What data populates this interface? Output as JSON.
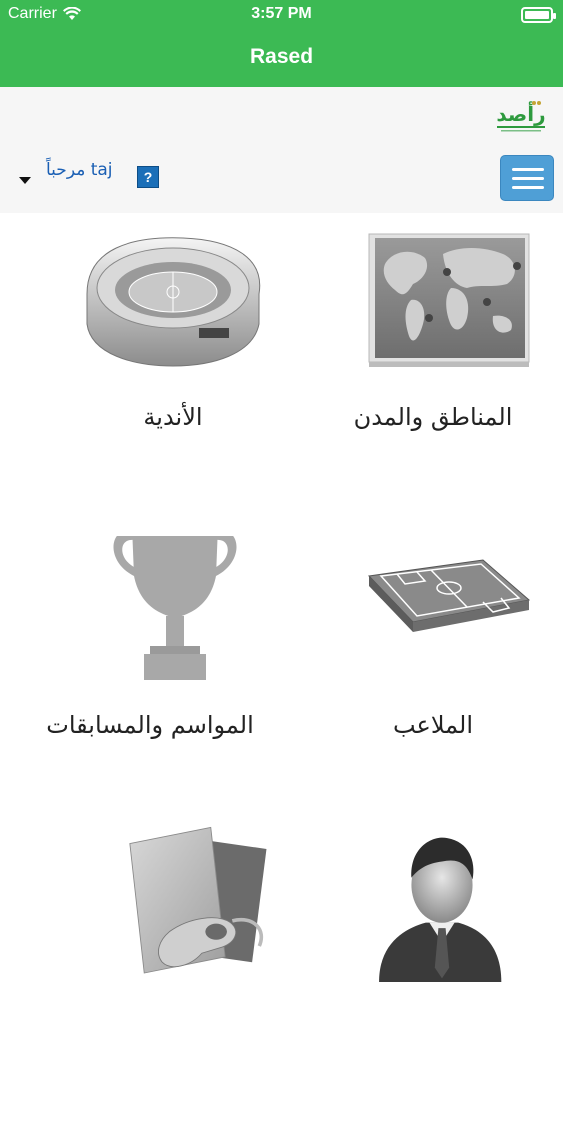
{
  "status_bar": {
    "carrier": "Carrier",
    "time": "3:57 PM"
  },
  "nav": {
    "title": "Rased"
  },
  "header": {
    "greeting": "مرحباً taj",
    "help_label": "?"
  },
  "menu": [
    {
      "key": "regions",
      "label": "المناطق والمدن",
      "icon": "world-map-icon"
    },
    {
      "key": "clubs",
      "label": "الأندية",
      "icon": "stadium-icon"
    },
    {
      "key": "stadiums",
      "label": "الملاعب",
      "icon": "football-field-icon"
    },
    {
      "key": "seasons",
      "label": "المواسم والمسابقات",
      "icon": "trophy-icon"
    },
    {
      "key": "persons",
      "label": "",
      "icon": "businessman-icon"
    },
    {
      "key": "referees",
      "label": "",
      "icon": "cards-whistle-icon"
    }
  ],
  "colors": {
    "primary_green": "#3cba54",
    "menu_blue": "#4f9fd6",
    "greeting_blue": "#1a5fb4"
  }
}
